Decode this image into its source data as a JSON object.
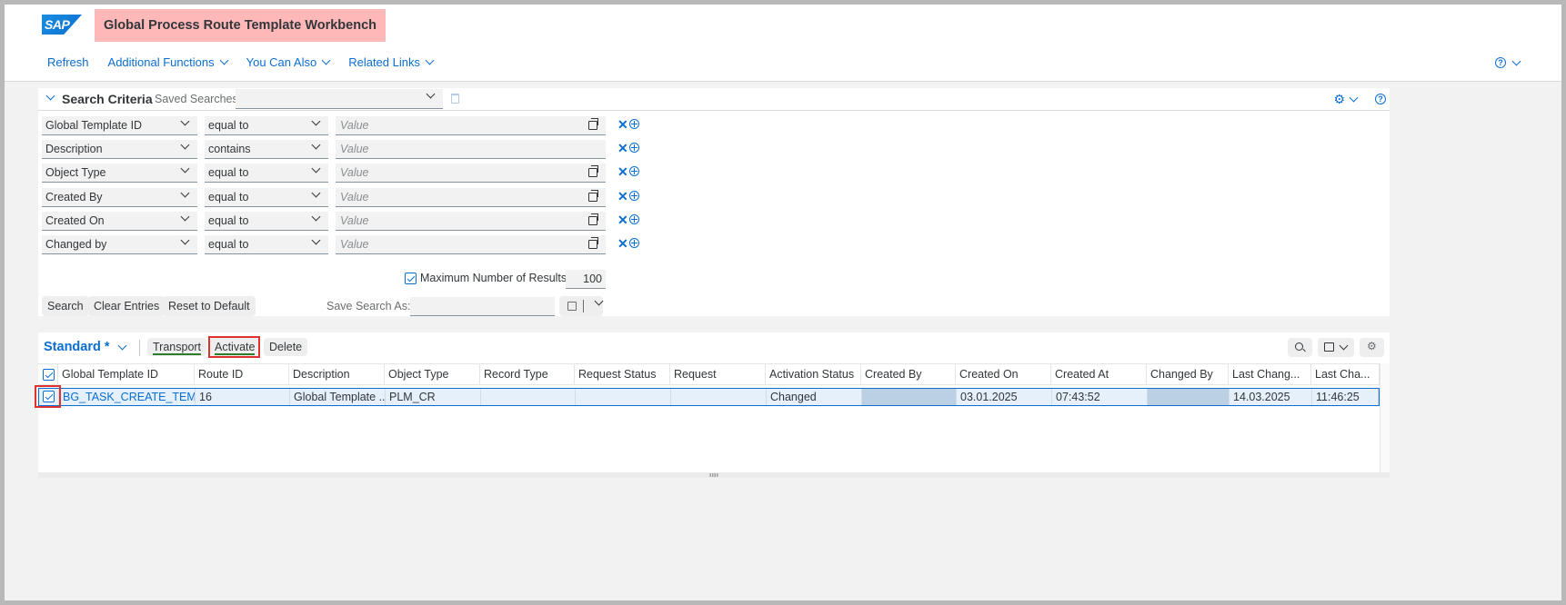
{
  "app": {
    "logo_text": "SAP",
    "title": "Global Process Route Template Workbench",
    "title_highlight": "#ffb8b8"
  },
  "menu": {
    "refresh": "Refresh",
    "additional_functions": "Additional Functions",
    "you_can_also": "You Can Also",
    "related_links": "Related Links",
    "help_icon": "question-circle-icon"
  },
  "search": {
    "title": "Search Criteria",
    "saved_searches_label": "Saved Searches:",
    "saved_searches_value": "",
    "criteria": [
      {
        "field": "Global Template ID",
        "operator": "equal to",
        "placeholder": "Value",
        "value_help": true
      },
      {
        "field": "Description",
        "operator": "contains",
        "placeholder": "Value",
        "value_help": false
      },
      {
        "field": "Object Type",
        "operator": "equal to",
        "placeholder": "Value",
        "value_help": true
      },
      {
        "field": "Created By",
        "operator": "equal to",
        "placeholder": "Value",
        "value_help": true
      },
      {
        "field": "Created On",
        "operator": "equal to",
        "placeholder": "Value",
        "value_help": true
      },
      {
        "field": "Changed by",
        "operator": "equal to",
        "placeholder": "Value",
        "value_help": true
      }
    ],
    "max_results_label": "Maximum Number of Results:",
    "max_results_checked": true,
    "max_results_value": "100",
    "buttons": {
      "search": "Search",
      "clear": "Clear Entries",
      "reset": "Reset to Default"
    },
    "save_search_as_label": "Save Search As:",
    "save_search_as_value": ""
  },
  "results": {
    "variant": "Standard *",
    "toolbar": {
      "transport": "Transport",
      "activate": "Activate",
      "delete": "Delete"
    },
    "highlight_color": "#e03131",
    "columns": [
      "Global Template ID",
      "Route ID",
      "Description",
      "Object Type",
      "Record Type",
      "Request Status",
      "Request",
      "Activation Status",
      "Created By",
      "Created On",
      "Created At",
      "Changed By",
      "Last Chang...",
      "Last Cha..."
    ],
    "rows": [
      {
        "selected": true,
        "global_template_id": "BG_TASK_CREATE_TEMPL",
        "route_id": "16",
        "description": "Global Template ...",
        "object_type": "PLM_CR",
        "record_type": "",
        "request_status": "",
        "request": "",
        "activation_status": "Changed",
        "created_by": "",
        "created_on": "03.01.2025",
        "created_at": "07:43:52",
        "changed_by": "",
        "last_changed_on": "14.03.2025",
        "last_changed_at": "11:46:25"
      }
    ]
  }
}
